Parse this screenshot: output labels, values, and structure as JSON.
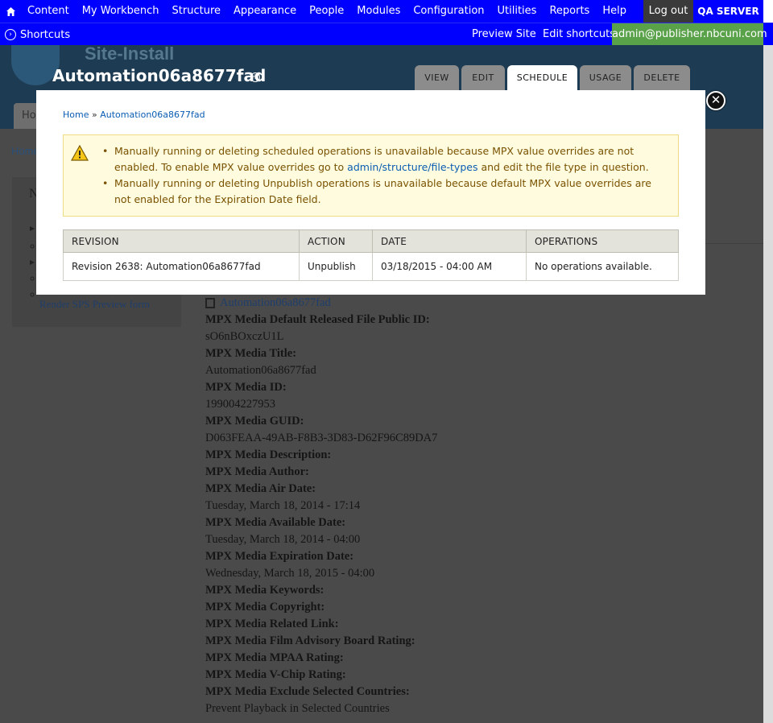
{
  "toolbar": {
    "menu": [
      "Content",
      "My Workbench",
      "Structure",
      "Appearance",
      "People",
      "Modules",
      "Configuration",
      "Utilities",
      "Reports",
      "Help"
    ],
    "logout": "Log out",
    "server": "QA SERVER"
  },
  "shortcuts": {
    "label": "Shortcuts",
    "preview": "Preview Site",
    "edit": "Edit shortcuts",
    "user": "admin@publisher.nbcuni.com"
  },
  "header": {
    "site_name": "Site-Install",
    "title": "Automation06a8677fad",
    "tabs": [
      "VIEW",
      "EDIT",
      "SCHEDULE",
      "USAGE",
      "DELETE"
    ],
    "active_tab": "SCHEDULE",
    "home_tab": "Ho"
  },
  "background": {
    "breadcrumb": "Home",
    "sidebar_heading": "N",
    "sidebar_link": "Render SPS Preview form"
  },
  "file": {
    "name": "Automation06a8677fad",
    "fields": [
      {
        "label": "MPX Media Default Released File Public ID:",
        "value": "sO6nBOxczU1L"
      },
      {
        "label": "MPX Media Title:",
        "value": "Automation06a8677fad"
      },
      {
        "label": "MPX Media ID:",
        "value": "199004227953"
      },
      {
        "label": "MPX Media GUID:",
        "value": "D063FEAA-49AB-F8B3-3D83-D62F96C89DA7"
      },
      {
        "label": "MPX Media Description:",
        "value": ""
      },
      {
        "label": "MPX Media Author:",
        "value": ""
      },
      {
        "label": "MPX Media Air Date:",
        "value": "Tuesday, March 18, 2014 - 17:14"
      },
      {
        "label": "MPX Media Available Date:",
        "value": "Tuesday, March 18, 2014 - 04:00"
      },
      {
        "label": "MPX Media Expiration Date:",
        "value": "Wednesday, March 18, 2015 - 04:00"
      },
      {
        "label": "MPX Media Keywords:",
        "value": ""
      },
      {
        "label": "MPX Media Copyright:",
        "value": ""
      },
      {
        "label": "MPX Media Related Link:",
        "value": ""
      },
      {
        "label": "MPX Media Film Advisory Board Rating:",
        "value": ""
      },
      {
        "label": "MPX Media MPAA Rating:",
        "value": ""
      },
      {
        "label": "MPX Media V-Chip Rating:",
        "value": ""
      },
      {
        "label": "MPX Media Exclude Selected Countries:",
        "value": "Prevent Playback in Selected Countries"
      }
    ]
  },
  "modal": {
    "breadcrumb": {
      "home": "Home",
      "sep": "»",
      "current": "Automation06a8677fad"
    },
    "warning": {
      "item1_pre": "Manually running or deleting scheduled operations is unavailable because MPX value overrides are not enabled. To enable MPX value overrides go to ",
      "item1_link": "admin/structure/file-types",
      "item1_post": " and edit the file type in question.",
      "item2": "Manually running or deleting Unpublish operations is unavailable because default MPX value overrides are not enabled for the Expiration Date field."
    },
    "table": {
      "headers": [
        "REVISION",
        "ACTION",
        "DATE",
        "OPERATIONS"
      ],
      "rows": [
        {
          "revision": "Revision 2638: Automation06a8677fad",
          "action": "Unpublish",
          "date": "03/18/2015 - 04:00 AM",
          "operations": "No operations available."
        }
      ]
    },
    "close": "✕"
  },
  "colors": {
    "toolbar": "#0000ff",
    "user_badge": "#5aa24a",
    "warning_bg": "#fefbde",
    "warning_text": "#7a5200",
    "link": "#0a5db2"
  }
}
